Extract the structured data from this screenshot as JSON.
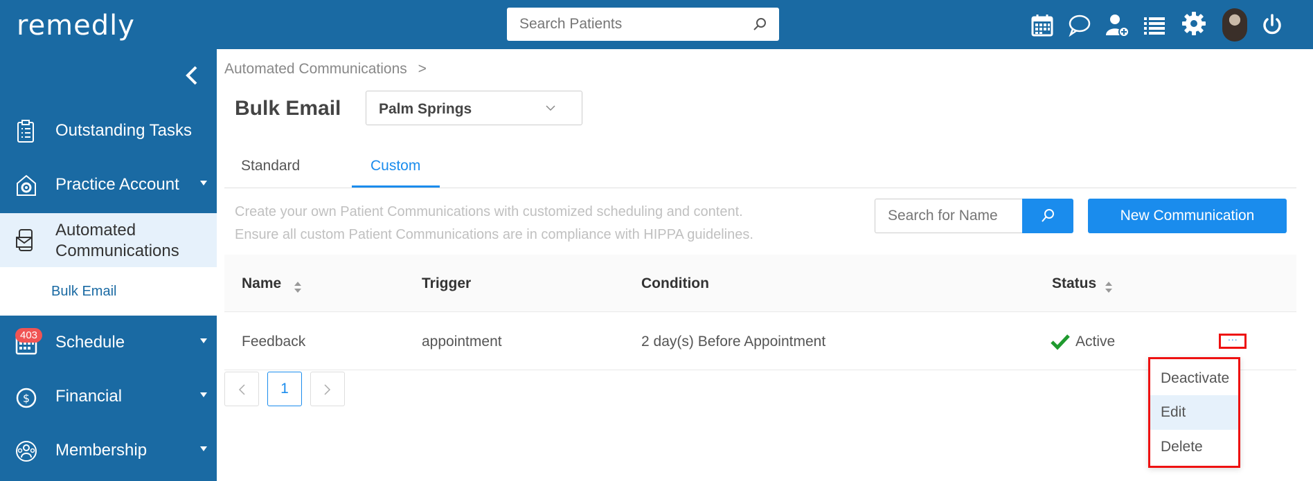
{
  "app": {
    "logo_text": "remedly"
  },
  "search": {
    "placeholder": "Search Patients"
  },
  "header_icons": [
    "calendar-icon",
    "chat-icon",
    "add-user-icon",
    "list-icon",
    "gear-icon",
    "avatar",
    "power-icon"
  ],
  "sidebar": {
    "items": [
      {
        "label": "Outstanding Tasks",
        "icon": "clipboard-icon",
        "has_caret": false
      },
      {
        "label": "Practice Account",
        "icon": "gear-house-icon",
        "has_caret": true
      },
      {
        "label": "Automated Communications",
        "icon": "phone-mail-icon",
        "has_caret": false,
        "active": true
      },
      {
        "label": "Schedule",
        "icon": "calendar-icon",
        "has_caret": true
      },
      {
        "label": "Financial",
        "icon": "dollar-icon",
        "has_caret": true,
        "badge": "403"
      },
      {
        "label": "Membership",
        "icon": "membership-icon",
        "has_caret": true
      }
    ],
    "subitem": "Bulk Email"
  },
  "breadcrumb": {
    "text": "Automated Communications",
    "separator": ">"
  },
  "page": {
    "title": "Bulk Email",
    "location": "Palm Springs"
  },
  "tabs": [
    {
      "label": "Standard",
      "active": false
    },
    {
      "label": "Custom",
      "active": true
    }
  ],
  "description": {
    "line1": "Create your own Patient Communications with customized scheduling and content.",
    "line2": "Ensure all custom Patient Communications are in compliance with HIPPA guidelines."
  },
  "name_search": {
    "placeholder": "Search for Name"
  },
  "new_button": "New Communication",
  "table": {
    "headers": [
      "Name",
      "Trigger",
      "Condition",
      "Status"
    ],
    "rows": [
      {
        "name": "Feedback",
        "trigger": "appointment",
        "condition": "2 day(s) Before Appointment",
        "status": "Active",
        "actions": "..."
      }
    ]
  },
  "pagination": {
    "current": "1"
  },
  "action_menu": {
    "items": [
      "Deactivate",
      "Edit",
      "Delete"
    ],
    "highlighted": "Edit"
  },
  "colors": {
    "primary": "#1a6aa3",
    "accent": "#1a8ced",
    "active_bg": "#e6f1fb",
    "status_green": "#1f9a2e",
    "highlight_red": "#e11111",
    "badge_red": "#f05454"
  }
}
